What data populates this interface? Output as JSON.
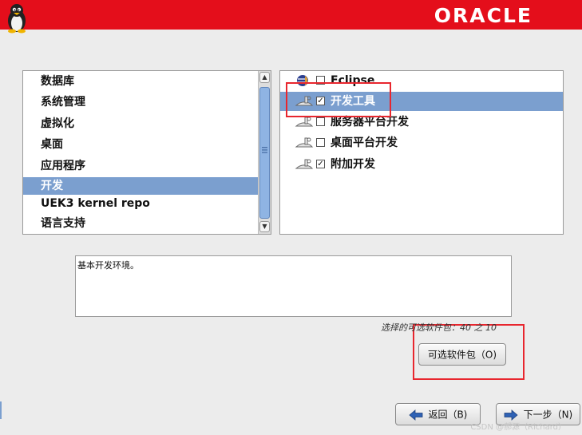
{
  "header": {
    "logo_text": "ORACLE",
    "bg_color": "#e40e1b",
    "icon": "tux-penguin-icon"
  },
  "categories": {
    "selected_index": 5,
    "items": [
      {
        "label": "数据库"
      },
      {
        "label": "系统管理"
      },
      {
        "label": "虚拟化"
      },
      {
        "label": "桌面"
      },
      {
        "label": "应用程序"
      },
      {
        "label": "开发"
      },
      {
        "label": "UEK3 kernel repo"
      },
      {
        "label": "语言支持"
      }
    ]
  },
  "groups": {
    "items": [
      {
        "label": "Eclipse",
        "checked": false,
        "selected": false,
        "icon": "eclipse-globe-icon"
      },
      {
        "label": "开发工具",
        "checked": true,
        "selected": true,
        "icon": "tools-icon"
      },
      {
        "label": "服务器平台开发",
        "checked": false,
        "selected": false,
        "icon": "tools-icon"
      },
      {
        "label": "桌面平台开发",
        "checked": false,
        "selected": false,
        "icon": "tools-icon"
      },
      {
        "label": "附加开发",
        "checked": true,
        "selected": false,
        "icon": "tools-icon"
      }
    ]
  },
  "description": {
    "text": "基本开发环境。"
  },
  "package_count": {
    "text": "选择的可选软件包：40 之 10"
  },
  "buttons": {
    "optional_packages": "可选软件包（O)",
    "back": "返回（B)",
    "next": "下一步（N)"
  },
  "watermark": {
    "text": "CSDN @郝源（Richard）"
  },
  "colors": {
    "selection": "#7b9fcf",
    "annotation_red": "#e8262e",
    "scrollbar_thumb": "#8fb4e3"
  }
}
